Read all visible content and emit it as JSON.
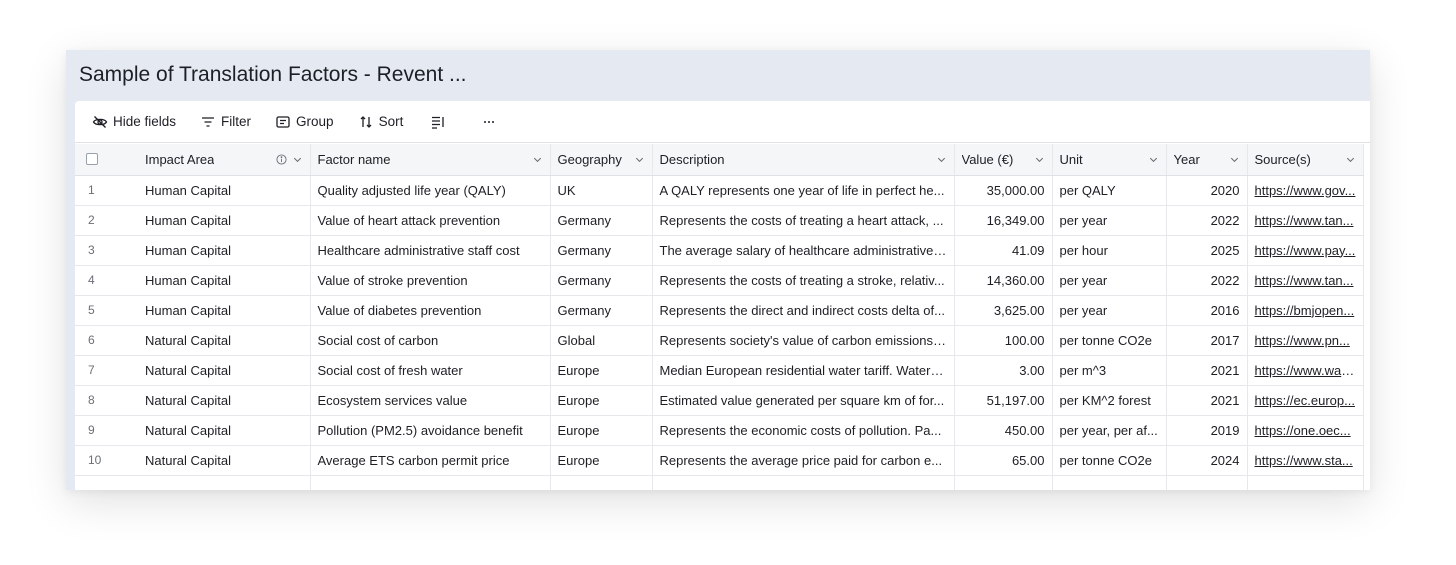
{
  "title": "Sample of Translation Factors - Revent ...",
  "toolbar": {
    "hide_fields": "Hide fields",
    "filter": "Filter",
    "group": "Group",
    "sort": "Sort"
  },
  "columns": {
    "impact_area": "Impact Area",
    "factor_name": "Factor name",
    "geography": "Geography",
    "description": "Description",
    "value": "Value (€)",
    "unit": "Unit",
    "year": "Year",
    "sources": "Source(s)"
  },
  "rows": [
    {
      "n": "1",
      "impact": "Human Capital",
      "factor": "Quality adjusted life year (QALY)",
      "geo": "UK",
      "desc": "A QALY represents one year of life in perfect he...",
      "value": "35,000.00",
      "unit": "per QALY",
      "year": "2020",
      "source": "https://www.gov..."
    },
    {
      "n": "2",
      "impact": "Human Capital",
      "factor": "Value of heart attack prevention",
      "geo": "Germany",
      "desc": "Represents the costs of treating a heart attack, ...",
      "value": "16,349.00",
      "unit": "per year",
      "year": "2022",
      "source": "https://www.tan..."
    },
    {
      "n": "3",
      "impact": "Human Capital",
      "factor": "Healthcare administrative staff cost",
      "geo": "Germany",
      "desc": "The average salary of healthcare administrative ...",
      "value": "41.09",
      "unit": "per hour",
      "year": "2025",
      "source": "https://www.pay..."
    },
    {
      "n": "4",
      "impact": "Human Capital",
      "factor": "Value of stroke prevention",
      "geo": "Germany",
      "desc": "Represents the costs of treating a stroke, relativ...",
      "value": "14,360.00",
      "unit": "per year",
      "year": "2022",
      "source": "https://www.tan..."
    },
    {
      "n": "5",
      "impact": "Human Capital",
      "factor": "Value of diabetes prevention",
      "geo": "Germany",
      "desc": "Represents the direct and indirect costs delta of...",
      "value": "3,625.00",
      "unit": "per year",
      "year": "2016",
      "source": "https://bmjopen..."
    },
    {
      "n": "6",
      "impact": "Natural Capital",
      "factor": "Social cost of carbon",
      "geo": "Global",
      "desc": "Represents society's value of carbon emissions;...",
      "value": "100.00",
      "unit": "per tonne CO2e",
      "year": "2017",
      "source": "https://www.pn..."
    },
    {
      "n": "7",
      "impact": "Natural Capital",
      "factor": "Social cost of fresh water",
      "geo": "Europe",
      "desc": "Median European residential water tariff. Water i...",
      "value": "3.00",
      "unit": "per m^3",
      "year": "2021",
      "source": "https://www.wat..."
    },
    {
      "n": "8",
      "impact": "Natural Capital",
      "factor": "Ecosystem services value",
      "geo": "Europe",
      "desc": "Estimated value generated per square km of for...",
      "value": "51,197.00",
      "unit": "per KM^2 forest",
      "year": "2021",
      "source": "https://ec.europ..."
    },
    {
      "n": "9",
      "impact": "Natural Capital",
      "factor": "Pollution (PM2.5) avoidance benefit",
      "geo": "Europe",
      "desc": "Represents the economic costs of pollution. Pa...",
      "value": "450.00",
      "unit": "per year, per af...",
      "year": "2019",
      "source": "https://one.oec..."
    },
    {
      "n": "10",
      "impact": "Natural Capital",
      "factor": "Average ETS carbon permit price",
      "geo": "Europe",
      "desc": "Represents the average price paid for carbon e...",
      "value": "65.00",
      "unit": "per tonne CO2e",
      "year": "2024",
      "source": "https://www.sta..."
    }
  ]
}
